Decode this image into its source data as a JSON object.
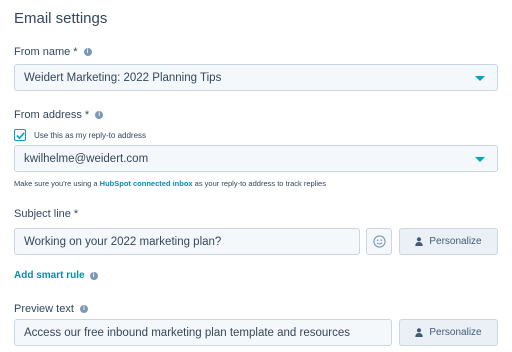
{
  "header": {
    "title": "Email settings"
  },
  "from_name": {
    "label": "From name *",
    "value": "Weidert Marketing: 2022 Planning Tips"
  },
  "from_address": {
    "label": "From address *",
    "reply_to_checkbox_label": "Use this as my reply-to address",
    "reply_to_checked": true,
    "value": "kwilhelme@weidert.com",
    "hint_prefix": "Make sure you're using a ",
    "hint_link": "HubSpot connected inbox",
    "hint_suffix": " as your reply-to address to track replies"
  },
  "subject": {
    "label": "Subject line *",
    "value": "Working on your 2022 marketing plan?",
    "personalize_label": "Personalize"
  },
  "smart_rule": {
    "label": "Add smart rule"
  },
  "preview": {
    "label": "Preview text",
    "value": "Access our free inbound marketing plan template and resources",
    "personalize_label": "Personalize"
  },
  "colors": {
    "accent": "#00a4bd",
    "link": "#0091ae",
    "text": "#33475b",
    "field_bg": "#f5f8fa",
    "border": "#cbd6e2"
  },
  "icons": [
    "info-icon",
    "caret-down-icon",
    "checkmark-icon",
    "emoji-icon",
    "person-icon"
  ]
}
